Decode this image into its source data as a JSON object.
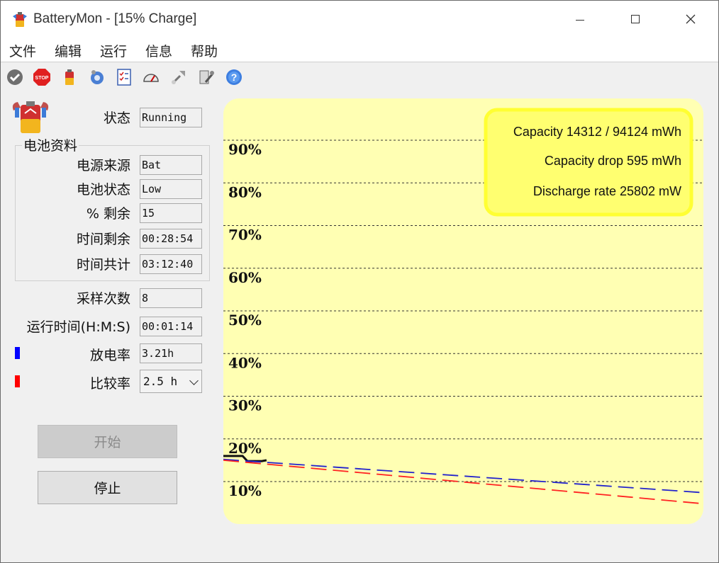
{
  "window": {
    "title": "BatteryMon - [15% Charge]",
    "controls": {
      "minimize": "—",
      "maximize": "☐",
      "close": "✕"
    }
  },
  "menu": {
    "items": [
      "文件",
      "编辑",
      "运行",
      "信息",
      "帮助"
    ]
  },
  "toolbar": {
    "icons": [
      "check-icon",
      "stop-icon",
      "battery-icon",
      "settings-gear-icon",
      "checklist-icon",
      "gauge-icon",
      "tools-icon",
      "wrench-icon",
      "help-icon"
    ],
    "stop_text": "STOP",
    "help_text": "?"
  },
  "status": {
    "label": "状态",
    "value": "Running"
  },
  "battery_info": {
    "title": "电池资料",
    "power_source": {
      "label": "电源来源",
      "value": "Bat"
    },
    "battery_status": {
      "label": "电池状态",
      "value": "Low"
    },
    "percent_left": {
      "label": "% 剩余",
      "value": "15"
    },
    "time_left": {
      "label": "时间剩余",
      "value": "00:28:54"
    },
    "total_time": {
      "label": "时间共计",
      "value": "03:12:40"
    }
  },
  "samples": {
    "label": "采样次数",
    "value": "8"
  },
  "runtime": {
    "label": "运行时间(H:M:S)",
    "value": "00:01:14"
  },
  "discharge_rate": {
    "label": "放电率",
    "value": "3.21h",
    "color": "#0000ff"
  },
  "compare_rate": {
    "label": "比较率",
    "value": "2.5 h",
    "color": "#ff0000"
  },
  "buttons": {
    "start": "开始",
    "stop": "停止"
  },
  "info_box": {
    "capacity": "Capacity 14312 / 94124 mWh",
    "capacity_drop": "Capacity drop 595 mWh",
    "discharge_rate": "Discharge rate 25802 mW"
  },
  "chart_data": {
    "type": "line",
    "ylim": [
      0,
      100
    ],
    "yticks": [
      90,
      80,
      70,
      60,
      50,
      40,
      30,
      20,
      10
    ],
    "ytick_labels": [
      "90%",
      "80%",
      "70%",
      "60%",
      "50%",
      "40%",
      "30%",
      "20%",
      "10%"
    ],
    "grid": true,
    "colors": {
      "background": "#ffffb3",
      "grid": "#333333",
      "info_bg": "#ffff70",
      "info_border": "#ffff33"
    },
    "series": [
      {
        "name": "",
        "color": "#111111",
        "style": "solid",
        "values": [
          [
            0,
            16.0
          ],
          [
            4,
            16.0
          ],
          [
            5,
            14.8
          ],
          [
            8,
            14.8
          ],
          [
            9,
            15.0
          ]
        ]
      },
      {
        "name": "",
        "color": "#2222cc",
        "style": "dashed",
        "values": [
          [
            0,
            15.2
          ],
          [
            100,
            7.4
          ]
        ]
      },
      {
        "name": "",
        "color": "#ff2222",
        "style": "dashed",
        "values": [
          [
            0,
            15.0
          ],
          [
            100,
            4.8
          ]
        ]
      }
    ]
  }
}
